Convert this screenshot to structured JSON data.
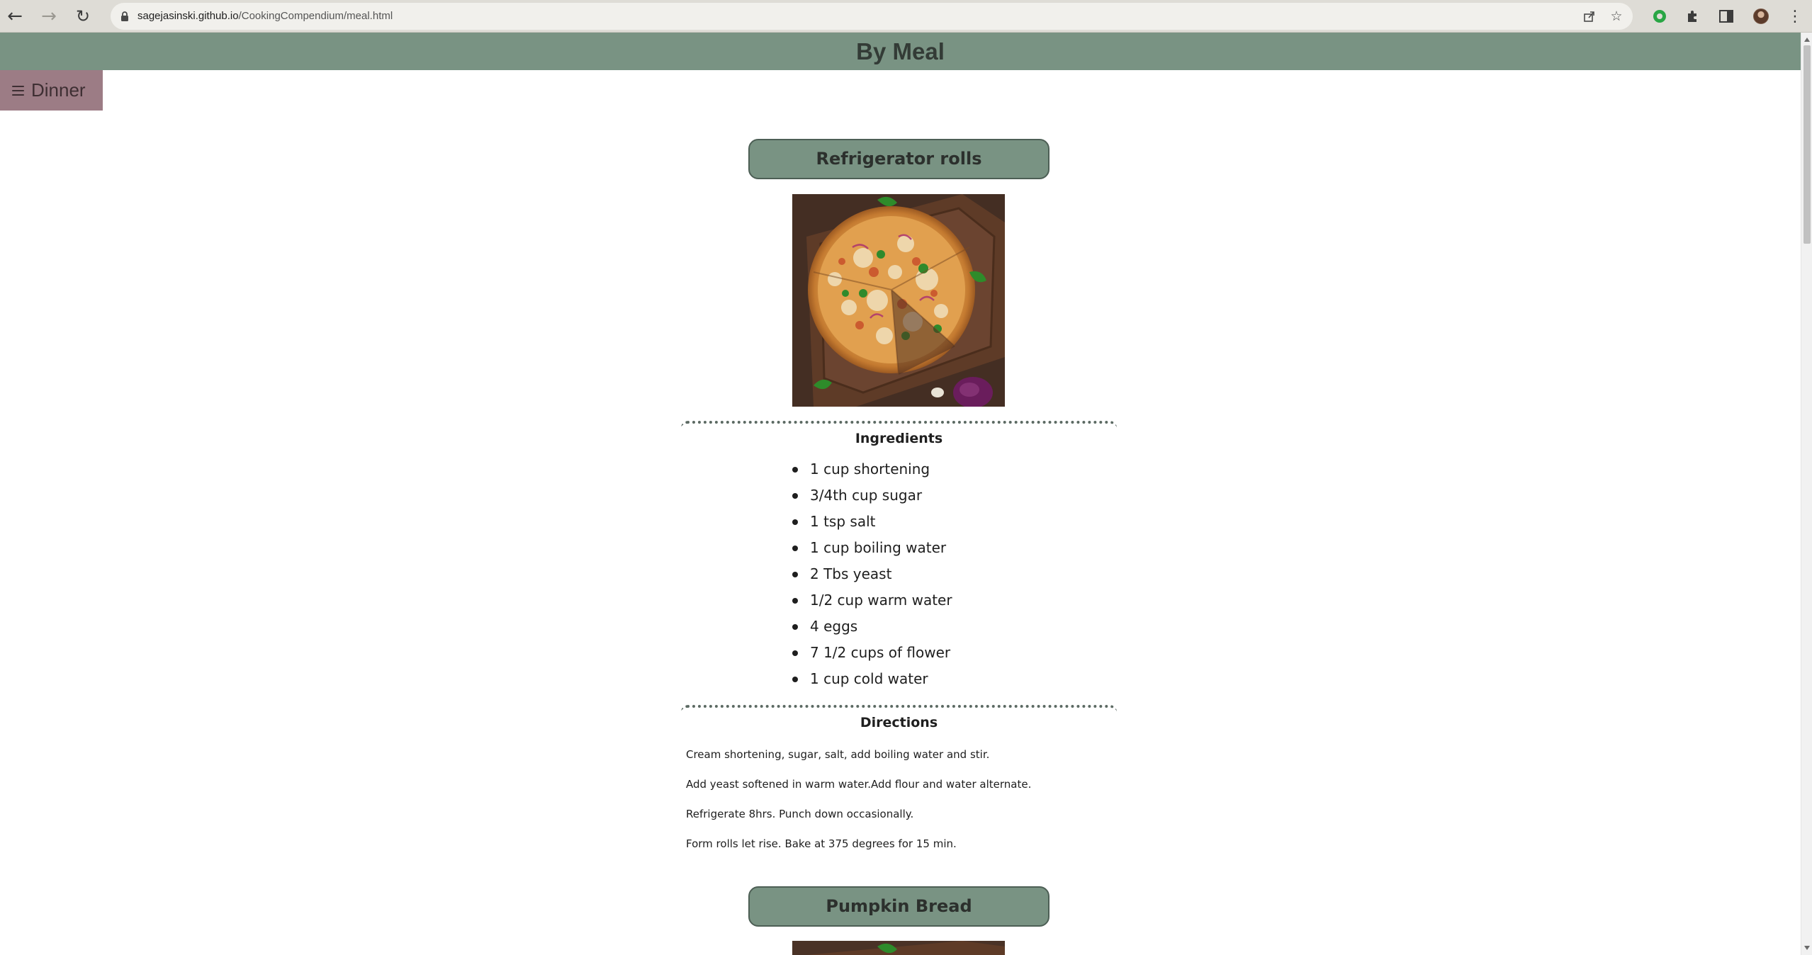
{
  "browser": {
    "url_host": "sagejasinski.github.io",
    "url_path": "/CookingCompendium/meal.html"
  },
  "header": {
    "title": "By Meal"
  },
  "menu": {
    "current": "Dinner"
  },
  "recipes": [
    {
      "title": "Refrigerator rolls",
      "ingredients_heading": "Ingredients",
      "ingredients": [
        "1 cup shortening",
        "3/4th cup sugar",
        "1 tsp salt",
        "1 cup boiling water",
        "2 Tbs yeast",
        "1/2 cup warm water",
        "4 eggs",
        "7 1/2 cups of flower",
        "1 cup cold water"
      ],
      "directions_heading": "Directions",
      "directions": [
        "Cream shortening, sugar, salt, add boiling water and stir.",
        "Add yeast softened in warm water.Add flour and water alternate.",
        "Refrigerate 8hrs. Punch down occasionally.",
        "Form rolls let rise. Bake at 375 degrees for 15 min."
      ]
    },
    {
      "title": "Pumpkin Bread"
    }
  ],
  "colors": {
    "header_bg": "#799383",
    "menu_bg": "#9c7c85",
    "title_border": "#4d5f55"
  }
}
